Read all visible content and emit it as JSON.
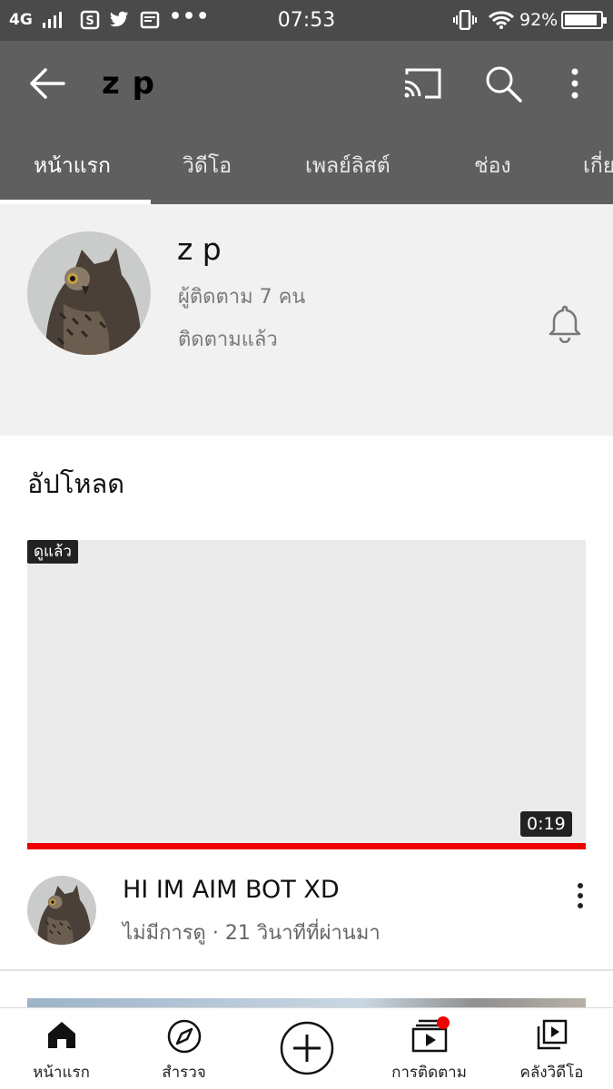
{
  "status_bar": {
    "network": "4G",
    "time": "07:53",
    "battery_percent": "92%",
    "battery_level": 0.92,
    "icons": [
      "signal-bars-icon",
      "s-app-icon",
      "twitter-icon",
      "message-icon",
      "more-dots-icon",
      "vibrate-icon",
      "wifi-icon",
      "battery-icon"
    ],
    "dots": "•••"
  },
  "app_bar": {
    "title": "z p",
    "icons": [
      "back-arrow-icon",
      "cast-icon",
      "search-icon",
      "more-vertical-icon"
    ],
    "background": "#5f5f5f"
  },
  "tabs": [
    {
      "label": "หน้าแรก",
      "active": true
    },
    {
      "label": "วิดีโอ",
      "active": false
    },
    {
      "label": "เพลย์ลิสต์",
      "active": false
    },
    {
      "label": "ช่อง",
      "active": false
    },
    {
      "label": "เกี่ย",
      "active": false
    }
  ],
  "channel": {
    "name": "z p",
    "subscribers": "ผู้ติดตาม 7 คน",
    "subscribed_status": "ติดตามแล้ว",
    "avatar_icon": "owl-avatar",
    "bell_icon": "bell-icon"
  },
  "section": {
    "title": "อัปโหลด"
  },
  "video": {
    "watched_label": "ดูแล้ว",
    "duration": "0:19",
    "watched_progress": 1.0,
    "title": "HI IM AIM BOT XD",
    "meta": "ไม่มีการดู · 21 วินาทีที่ผ่านมา",
    "more_icon": "more-vertical-icon",
    "progress_color": "#ee0000"
  },
  "bottom_nav": [
    {
      "label": "หน้าแรก",
      "icon": "home-icon"
    },
    {
      "label": "สำรวจ",
      "icon": "compass-icon"
    },
    {
      "label": "",
      "icon": "add-icon"
    },
    {
      "label": "การติดตาม",
      "icon": "subscriptions-icon",
      "badge": true
    },
    {
      "label": "คลังวิดีโอ",
      "icon": "library-icon"
    }
  ]
}
